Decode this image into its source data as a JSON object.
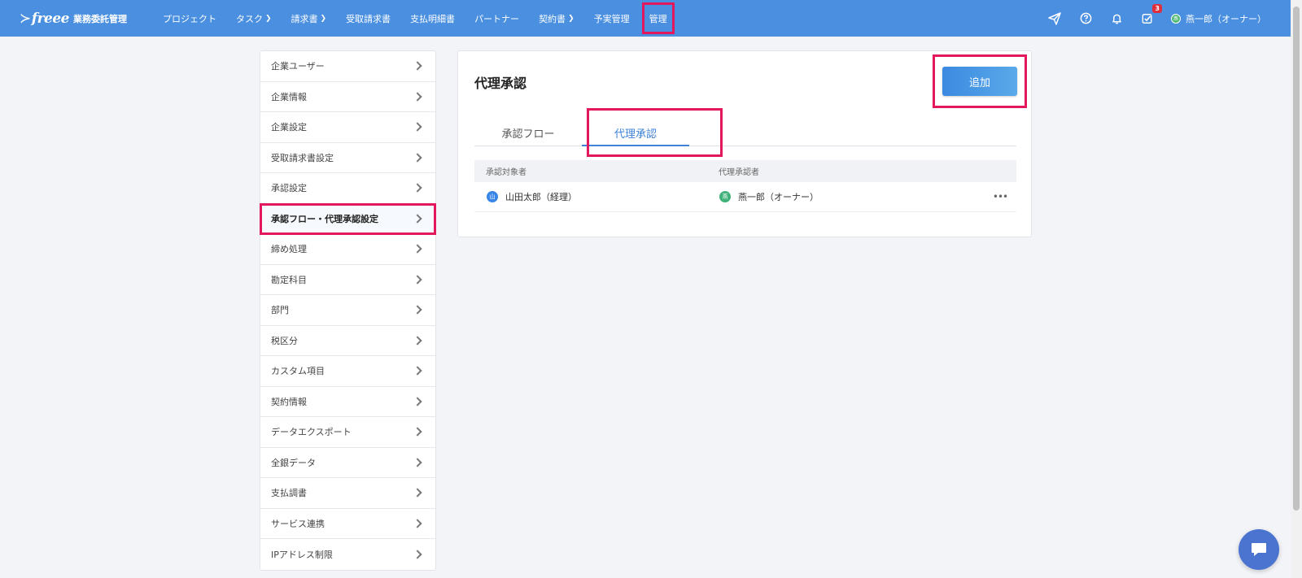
{
  "header": {
    "logo_text": "freee",
    "logo_sub": "業務委託管理",
    "nav": [
      {
        "label": "プロジェクト",
        "dropdown": false
      },
      {
        "label": "タスク",
        "dropdown": true
      },
      {
        "label": "請求書",
        "dropdown": true
      },
      {
        "label": "受取請求書",
        "dropdown": false
      },
      {
        "label": "支払明細書",
        "dropdown": false
      },
      {
        "label": "パートナー",
        "dropdown": false
      },
      {
        "label": "契約書",
        "dropdown": true
      },
      {
        "label": "予実管理",
        "dropdown": false
      },
      {
        "label": "管理",
        "dropdown": false
      }
    ],
    "task_badge": "3",
    "user_avatar": "燕",
    "user_name": "燕一郎（オーナー）"
  },
  "sidebar": {
    "items": [
      {
        "label": "企業ユーザー"
      },
      {
        "label": "企業情報"
      },
      {
        "label": "企業設定"
      },
      {
        "label": "受取請求書設定"
      },
      {
        "label": "承認設定"
      },
      {
        "label": "承認フロー・代理承認設定"
      },
      {
        "label": "締め処理"
      },
      {
        "label": "勘定科目"
      },
      {
        "label": "部門"
      },
      {
        "label": "税区分"
      },
      {
        "label": "カスタム項目"
      },
      {
        "label": "契約情報"
      },
      {
        "label": "データエクスポート"
      },
      {
        "label": "全銀データ"
      },
      {
        "label": "支払調書"
      },
      {
        "label": "サービス連携"
      },
      {
        "label": "IPアドレス制限"
      }
    ]
  },
  "main": {
    "title": "代理承認",
    "add_button": "追加",
    "tabs": [
      {
        "label": "承認フロー"
      },
      {
        "label": "代理承認"
      }
    ],
    "table": {
      "headers": [
        "承認対象者",
        "代理承認者"
      ],
      "rows": [
        {
          "target_avatar": "山",
          "target": "山田太郎（経理）",
          "proxy_avatar": "燕",
          "proxy": "燕一郎（オーナー）",
          "more": "•••"
        }
      ]
    }
  },
  "colors": {
    "header_bg": "#4a8fe0",
    "accent": "#3d82d8",
    "highlight": "#e3175b",
    "chat": "#4a74cf"
  }
}
